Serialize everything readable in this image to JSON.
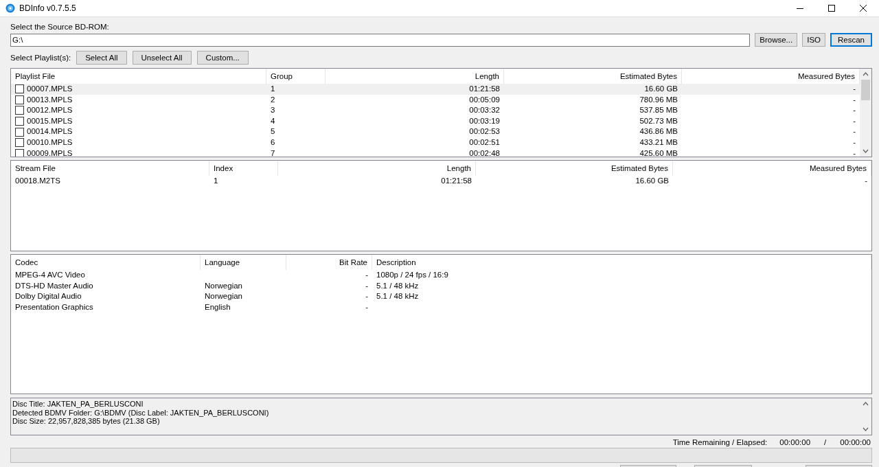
{
  "window": {
    "title": "BDInfo v0.7.5.5"
  },
  "source": {
    "label": "Select the Source BD-ROM:",
    "value": "G:\\",
    "buttons": [
      {
        "label": "Browse...",
        "default": false
      },
      {
        "label": "ISO",
        "default": false
      },
      {
        "label": "Rescan",
        "default": true
      }
    ]
  },
  "playlist_controls": {
    "label": "Select Playlist(s):",
    "buttons": [
      "Select All",
      "Unselect All",
      "Custom..."
    ]
  },
  "playlists": {
    "columns": [
      {
        "label": "Playlist File",
        "kind": "text"
      },
      {
        "label": "Group",
        "kind": "text"
      },
      {
        "label": "Length",
        "kind": "number"
      },
      {
        "label": "Estimated Bytes",
        "kind": "number"
      },
      {
        "label": "Measured Bytes",
        "kind": "number"
      }
    ],
    "rows": [
      {
        "cells": [
          "00007.MPLS",
          "1",
          "01:21:58",
          "16.60 GB",
          "-"
        ],
        "checked": false,
        "selected": true
      },
      {
        "cells": [
          "00013.MPLS",
          "2",
          "00:05:09",
          "780.96 MB",
          "-"
        ],
        "checked": false,
        "selected": false
      },
      {
        "cells": [
          "00012.MPLS",
          "3",
          "00:03:32",
          "537.85 MB",
          "-"
        ],
        "checked": false,
        "selected": false
      },
      {
        "cells": [
          "00015.MPLS",
          "4",
          "00:03:19",
          "502.73 MB",
          "-"
        ],
        "checked": false,
        "selected": false
      },
      {
        "cells": [
          "00014.MPLS",
          "5",
          "00:02:53",
          "436.86 MB",
          "-"
        ],
        "checked": false,
        "selected": false
      },
      {
        "cells": [
          "00010.MPLS",
          "6",
          "00:02:51",
          "433.21 MB",
          "-"
        ],
        "checked": false,
        "selected": false
      },
      {
        "cells": [
          "00009.MPLS",
          "7",
          "00:02:48",
          "425.60 MB",
          "-"
        ],
        "checked": false,
        "selected": false
      }
    ]
  },
  "streams": {
    "columns": [
      {
        "label": "Stream File",
        "kind": "text"
      },
      {
        "label": "Index",
        "kind": "text"
      },
      {
        "label": "Length",
        "kind": "number"
      },
      {
        "label": "Estimated Bytes",
        "kind": "number"
      },
      {
        "label": "Measured Bytes",
        "kind": "number"
      }
    ],
    "rows": [
      {
        "cells": [
          "00018.M2TS",
          "1",
          "01:21:58",
          "16.60 GB",
          "-"
        ]
      }
    ]
  },
  "codecs": {
    "columns": [
      {
        "label": "Codec",
        "kind": "text"
      },
      {
        "label": "Language",
        "kind": "text"
      },
      {
        "label": "Bit Rate",
        "kind": "number"
      },
      {
        "label": "Description",
        "kind": "text"
      }
    ],
    "rows": [
      {
        "cells": [
          "MPEG-4 AVC Video",
          "",
          "-",
          "1080p / 24 fps / 16:9"
        ]
      },
      {
        "cells": [
          "DTS-HD Master Audio",
          "Norwegian",
          "-",
          "5.1 / 48 kHz"
        ]
      },
      {
        "cells": [
          "Dolby Digital Audio",
          "Norwegian",
          "-",
          "5.1 / 48 kHz"
        ]
      },
      {
        "cells": [
          "Presentation Graphics",
          "English",
          "-",
          ""
        ]
      }
    ]
  },
  "disc_info": [
    "Disc Title: JAKTEN_PA_BERLUSCONI",
    "Detected BDMV Folder: G:\\BDMV (Disc Label: JAKTEN_PA_BERLUSCONI)",
    "Disc Size: 22,957,828,385 bytes (21.38 GB)"
  ],
  "time": {
    "label": "Time Remaining / Elapsed:",
    "remaining": "00:00:00",
    "separator": "/",
    "elapsed": "00:00:00"
  },
  "progress": {
    "level": 0
  }
}
